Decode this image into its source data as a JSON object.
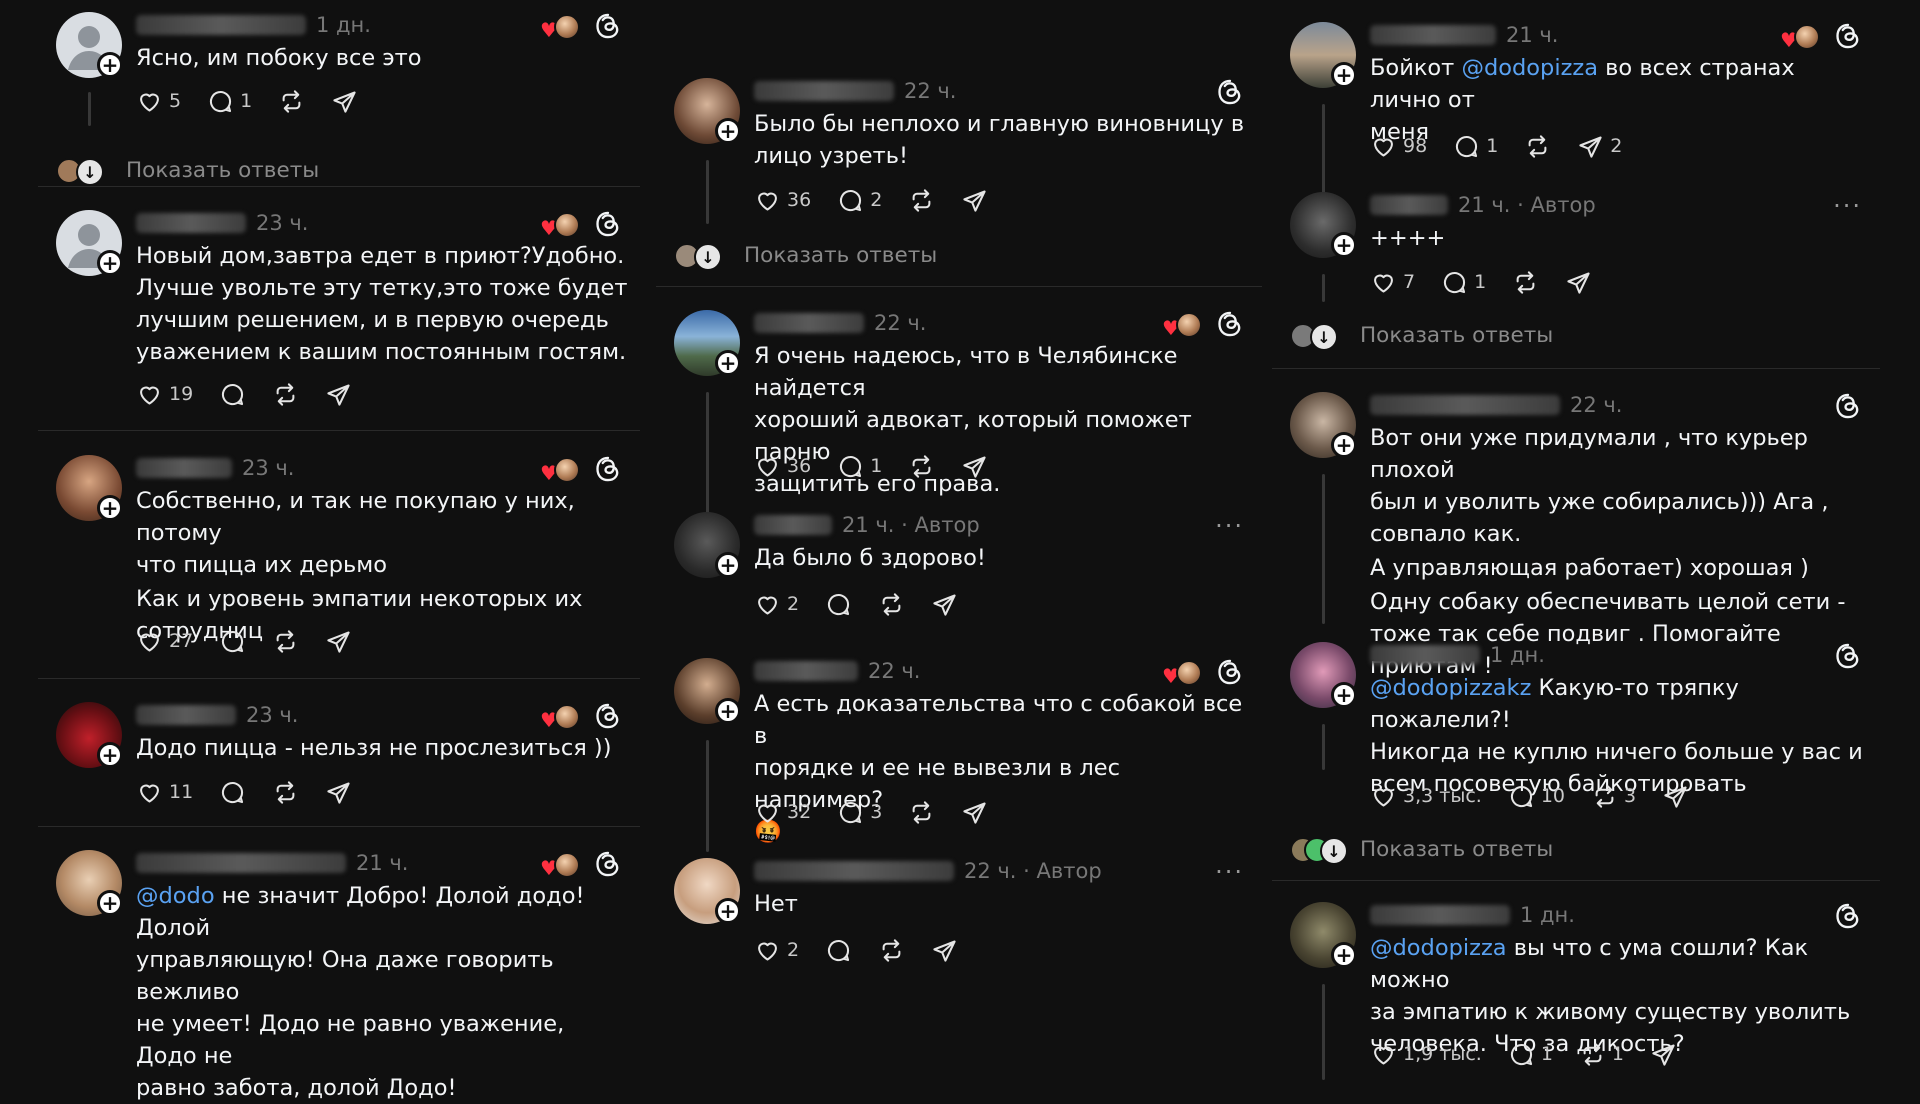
{
  "columns": [
    {
      "posts": [
        {
          "time": "1 дн.",
          "text": [
            "Ясно, им побоку все это"
          ],
          "likes": "5",
          "replies": "1",
          "reposts": "",
          "shares": "",
          "show_replies": "Показать ответы"
        },
        {
          "time": "23 ч.",
          "text": [
            "Новый дом,завтра едет в приют?Удобно.",
            "Лучше  увольте эту  тетку,это тоже  будет",
            "лучшим решением, и в первую очередь",
            "уважением к вашим постоянным гостям."
          ],
          "likes": "19",
          "replies": "",
          "reposts": "",
          "shares": ""
        },
        {
          "time": "23 ч.",
          "text": [
            "Собственно, и так не покупаю у них, потому",
            "что пицца их дерьмо"
          ],
          "text2": [
            "Как и уровень эмпатии некоторых их",
            "сотрудниц"
          ],
          "likes": "27",
          "replies": "",
          "reposts": "",
          "shares": ""
        },
        {
          "time": "23 ч.",
          "text": [
            "Додо пицца - нельзя не прослезиться ))"
          ],
          "likes": "11",
          "replies": "",
          "reposts": "",
          "shares": ""
        },
        {
          "time": "21 ч.",
          "mention": "@dodo",
          "text": [
            " не значит Добро! Долой додо! Долой",
            "управляющую! Она даже говорить вежливо",
            "не умеет! Додо не равно уважение, Додо не",
            "равно забота, долой Додо!"
          ]
        }
      ]
    },
    {
      "posts": [
        {
          "time": "22 ч.",
          "text": [
            "Было бы неплохо и главную виновницу в",
            "лицо узреть!"
          ],
          "likes": "36",
          "replies": "2",
          "reposts": "",
          "shares": "",
          "show_replies": "Показать ответы"
        },
        {
          "time": "22 ч.",
          "text": [
            "Я очень надеюсь, что в Челябинске найдется",
            "хороший адвокат, который поможет парню",
            "защитить его права."
          ],
          "likes": "36",
          "replies": "1",
          "reposts": "",
          "shares": ""
        },
        {
          "time": "21 ч. · Автор",
          "text": [
            "Да было б здорово!"
          ],
          "likes": "2",
          "replies": "",
          "reposts": "",
          "shares": ""
        },
        {
          "time": "22 ч.",
          "text": [
            "А есть доказательства что с собакой все в",
            "порядке и ее не вывезли в лес например?"
          ],
          "emoji": "🤬",
          "likes": "32",
          "replies": "3",
          "reposts": "",
          "shares": ""
        },
        {
          "time": "22 ч. · Автор",
          "text": [
            "Нет"
          ],
          "likes": "2",
          "replies": "",
          "reposts": "",
          "shares": ""
        }
      ]
    },
    {
      "posts": [
        {
          "time": "21 ч.",
          "pre": "Бойкот ",
          "mention": "@dodopizza",
          "text": [
            " во всех странах лично от",
            "меня"
          ],
          "likes": "98",
          "replies": "1",
          "reposts": "",
          "shares": "2"
        },
        {
          "time": "21 ч. · Автор",
          "text": [
            "++++"
          ],
          "likes": "7",
          "replies": "1",
          "reposts": "",
          "shares": "",
          "show_replies": "Показать ответы"
        },
        {
          "time": "22 ч.",
          "text": [
            "Вот они уже придумали , что курьер плохой",
            "был и уволить уже собирались))) Ага ,",
            "совпало как."
          ],
          "text2": [
            "А управляющая работает) хорошая )"
          ],
          "text3": [
            "Одну собаку обеспечивать целой сети -",
            "тоже так себе подвиг . Помогайте приютам !"
          ]
        },
        {
          "time": "1 дн.",
          "mention": "@dodopizzakz",
          "text": [
            " Какую-то тряпку пожалели?!",
            "Никогда не куплю ничего больше у вас и",
            "всем посоветую байкотировать"
          ],
          "likes": "3,3 тыс.",
          "replies": "10",
          "reposts": "3",
          "shares": "",
          "show_replies": "Показать ответы"
        },
        {
          "time": "1 дн.",
          "mention": "@dodopizza",
          "text": [
            "  вы что с ума сошли? Как можно",
            "за эмпатию к живому существу  уволить",
            "человека.  Что за дикость?"
          ],
          "likes": "1,9 тыс.",
          "replies": "1",
          "reposts": "1",
          "shares": ""
        }
      ]
    }
  ],
  "icons": {
    "like": "heart-icon",
    "reply": "comment-icon",
    "repost": "repost-icon",
    "share": "share-icon",
    "threads": "threads-logo-icon",
    "more": "more-icon"
  },
  "more_label": "···",
  "plus_label": "+",
  "colors": {
    "background": "#101010",
    "text": "#f3f5f7",
    "mention": "#5aa2f2",
    "muted": "#777777",
    "like_red": "#ff3040"
  }
}
